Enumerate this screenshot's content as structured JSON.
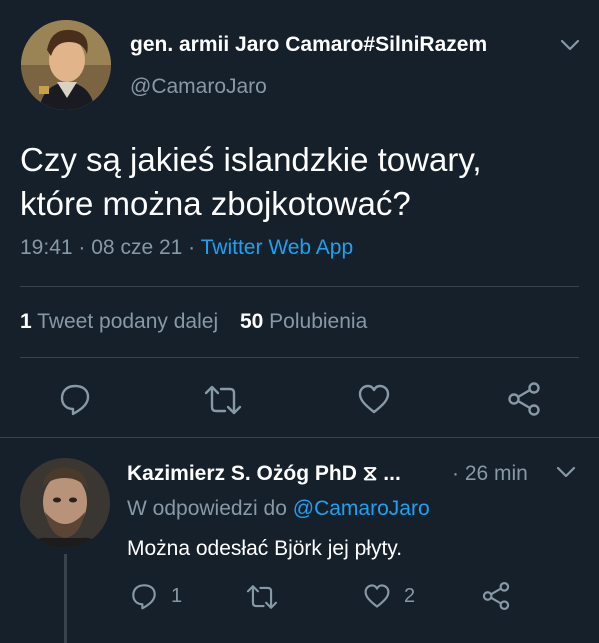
{
  "tweet": {
    "author_name": "gen. armii Jaro Camaro#SilniRazem",
    "author_handle": "@CamaroJaro",
    "text_line1": "Czy są jakieś islandzkie towary,",
    "text_line2": "które można zbojkotować?",
    "time": "19:41",
    "sep1": "·",
    "date": "08 cze 21",
    "sep2": "·",
    "source": "Twitter Web App",
    "retweets_count": "1",
    "retweets_label": "Tweet podany dalej",
    "likes_count": "50",
    "likes_label": "Polubienia"
  },
  "reply": {
    "author_name": "Kazimierz S. Ożóg PhD ⧖ ...",
    "time_ago": "· 26 min",
    "in_reply_prefix": "W odpowiedzi do",
    "in_reply_handle": "@CamaroJaro",
    "text": "Można odesłać Björk jej płyty.",
    "reply_count": "1",
    "like_count": "2"
  },
  "colors": {
    "background": "#15202b",
    "muted": "#8899a6",
    "link": "#1da1f2",
    "divider": "#38444d"
  },
  "icons": [
    "chevron-down-icon",
    "reply-icon",
    "retweet-icon",
    "like-icon",
    "share-icon"
  ]
}
